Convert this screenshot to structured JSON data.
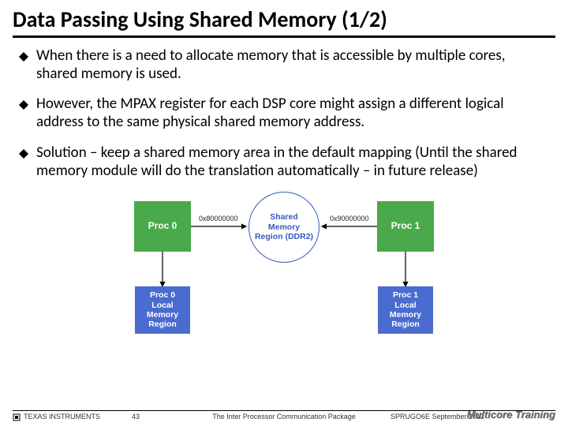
{
  "title": "Data Passing Using Shared Memory (1/2)",
  "bullets": [
    "When there is a need to allocate memory that is accessible by multiple cores, shared memory is used.",
    "However, the MPAX register for each DSP core might assign a different logical address to the same physical shared memory address.",
    "Solution – keep a shared memory area in the default mapping (Until the shared memory module will do the translation automatically – in future release)"
  ],
  "diagram": {
    "proc0": "Proc 0",
    "proc1": "Proc 1",
    "shared": "Shared Memory Region (DDR2)",
    "local0": "Proc 0 Local Memory Region",
    "local1": "Proc 1 Local Memory Region",
    "addr0": "0x80000000",
    "addr1": "0x90000000"
  },
  "footer": {
    "vendor": "TEXAS INSTRUMENTS",
    "page_num": "43",
    "package": "The Inter Processor Communication Package",
    "doc_id": "SPRUGO6E  September 2012",
    "brand": "Multicore Training"
  }
}
